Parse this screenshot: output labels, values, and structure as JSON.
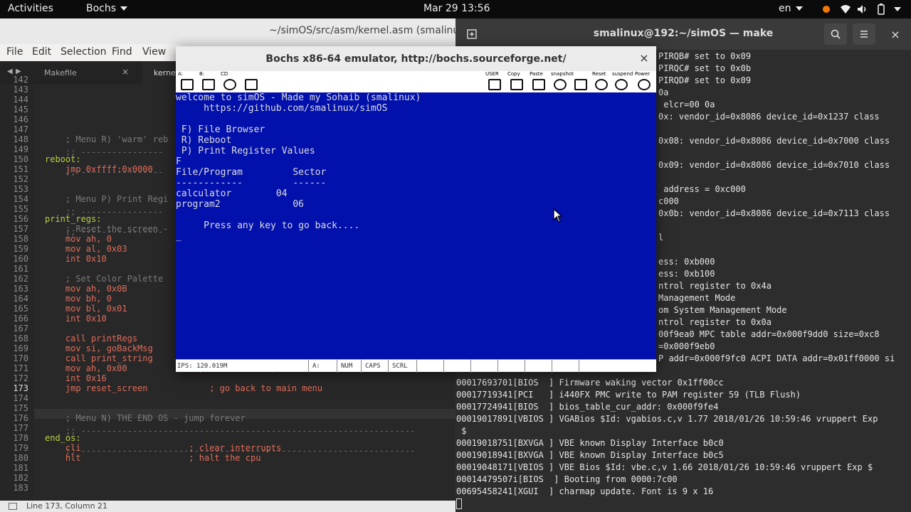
{
  "topbar": {
    "activities": "Activities",
    "app_menu": "Bochs",
    "clock": "Mar 29  13:56",
    "lang": "en"
  },
  "editor": {
    "title": "~/simOS/src/asm/kernel.asm (smalinuxOS",
    "menu": [
      "File",
      "Edit",
      "Selection",
      "Find",
      "View"
    ],
    "tabs": [
      {
        "label": "Makefile"
      },
      {
        "label": "kernel"
      }
    ],
    "statusbar": "Line 173, Column 21",
    "line_numbers": [
      "142",
      "143",
      "144",
      "145",
      "146",
      "147",
      "148",
      "149",
      "150",
      "151",
      "152",
      "153",
      "154",
      "155",
      "156",
      "157",
      "158",
      "159",
      "160",
      "161",
      "162",
      "163",
      "164",
      "165",
      "166",
      "167",
      "168",
      "169",
      "170",
      "171",
      "172",
      "173",
      "174",
      "175",
      "176",
      "177",
      "178",
      "179",
      "180",
      "181",
      "182",
      "183"
    ],
    "code": [
      {
        "n": "148",
        "t": "    ; Menu R) 'warm' reb"
      },
      {
        "n": "150",
        "t": "reboot:"
      },
      {
        "n": "151",
        "t": "    jmp 0xffff:0x0000"
      },
      {
        "n": "154",
        "t": "    ; Menu P) Print Regi"
      },
      {
        "n": "156",
        "t": "print_regs:"
      },
      {
        "n": "157",
        "t": "    ; Reset the screen -"
      },
      {
        "n": "158",
        "t": "    mov ah, 0"
      },
      {
        "n": "159",
        "t": "    mov al, 0x03"
      },
      {
        "n": "160",
        "t": "    int 0x10"
      },
      {
        "n": "162",
        "t": "    ; Set Color Palette"
      },
      {
        "n": "163",
        "t": "    mov ah, 0x0B"
      },
      {
        "n": "164",
        "t": "    mov bh, 0"
      },
      {
        "n": "165",
        "t": "    mov bl, 0x01"
      },
      {
        "n": "166",
        "t": "    int 0x10"
      },
      {
        "n": "168",
        "t": "    call printRegs"
      },
      {
        "n": "169",
        "t": "    mov si, goBackMsg"
      },
      {
        "n": "170",
        "t": "    call print_string"
      },
      {
        "n": "171",
        "t": "    mov ah, 0x00            ; pause screen :)"
      },
      {
        "n": "172",
        "t": "    int 0x16"
      },
      {
        "n": "173",
        "t": "    jmp reset_screen            ; go back to main menu"
      },
      {
        "n": "176",
        "t": "    ; Menu N) THE END OS - jump forever"
      },
      {
        "n": "178",
        "t": "end_os:"
      },
      {
        "n": "179",
        "t": "    cli                     ; clear interrupts"
      },
      {
        "n": "180",
        "t": "    hlt                     ; halt the cpu"
      }
    ]
  },
  "terminal": {
    "title": "smalinux@192:~/simOS — make",
    "lines": [
      "PIRQB# set to 0x09",
      "PIRQC# set to 0x0b",
      "PIRQD# set to 0x09",
      "0a",
      " elcr=00 0a",
      "0x: vendor_id=0x8086 device_id=0x1237 class",
      "",
      "0x08: vendor_id=0x8086 device_id=0x7000 class",
      "",
      "0x09: vendor_id=0x8086 device_id=0x7010 class",
      "",
      " address = 0xc000",
      "c000",
      "0x0b: vendor_id=0x8086 device_id=0x7113 class",
      "",
      "l",
      "",
      "ess: 0xb000",
      "ess: 0xb100",
      "ntrol register to 0x4a",
      "Management Mode",
      "om System Management Mode",
      "ntrol register to 0x0a",
      "00f9ea0 MPC table addr=0x000f9dd0 size=0xc8",
      "=0x000f9eb0",
      "P addr=0x000f9fc0 ACPI DATA addr=0x01ff0000 si",
      "",
      "00017693701[BIOS  ] Firmware waking vector 0x1ff00cc",
      "00017719341[PCI   ] i440FX PMC write to PAM register 59 (TLB Flush)",
      "00017724941[BIOS  ] bios_table_cur_addr: 0x000f9fe4",
      "00019017891[VBIOS ] VGABios $Id: vgabios.c,v 1.77 2018/01/26 10:59:46 vruppert Exp",
      " $",
      "00019018751[BXVGA ] VBE known Display Interface b0c0",
      "00019018941[BXVGA ] VBE known Display Interface b0c5",
      "00019048171[VBIOS ] VBE Bios $Id: vbe.c,v 1.66 2018/01/26 10:59:46 vruppert Exp $",
      "00014479507i[BIOS  ] Booting from 0000:7c00",
      "00695458241[XGUI  ] charmap update. Font is 9 x 16"
    ]
  },
  "bochs": {
    "title": "Bochs x86-64 emulator, http://bochs.sourceforge.net/",
    "toolbar_left": [
      {
        "label": "A:",
        "icon": "floppy-a-icon"
      },
      {
        "label": "B:",
        "icon": "floppy-b-icon"
      },
      {
        "label": "CD",
        "icon": "cdrom-icon"
      },
      {
        "label": "",
        "icon": "mouse-icon"
      }
    ],
    "toolbar_right": [
      {
        "label": "USER",
        "icon": "keyboard-icon"
      },
      {
        "label": "Copy",
        "icon": "copy-icon"
      },
      {
        "label": "Paste",
        "icon": "paste-icon"
      },
      {
        "label": "snapshot",
        "icon": "snapshot-icon"
      },
      {
        "label": "",
        "icon": "config-icon"
      },
      {
        "label": "Reset",
        "icon": "reset-icon"
      },
      {
        "label": "suspend",
        "icon": "suspend-icon"
      },
      {
        "label": "Power",
        "icon": "power-icon"
      }
    ],
    "screen_lines": [
      "welcome to simOS - Made my Sohaib (smalinux)",
      "     https://github.com/smalinux/simOS",
      "",
      " F) File Browser",
      " R) Reboot",
      " P) Print Register Values",
      "F",
      "File/Program         Sector",
      "------------         ------",
      "calculator        04",
      "program2             06",
      "",
      "     Press any key to go back....",
      "_"
    ],
    "status": {
      "ips": "IPS: 120.019M",
      "a": "A:",
      "num": "NUM",
      "caps": "CAPS",
      "scrl": "SCRL"
    }
  }
}
